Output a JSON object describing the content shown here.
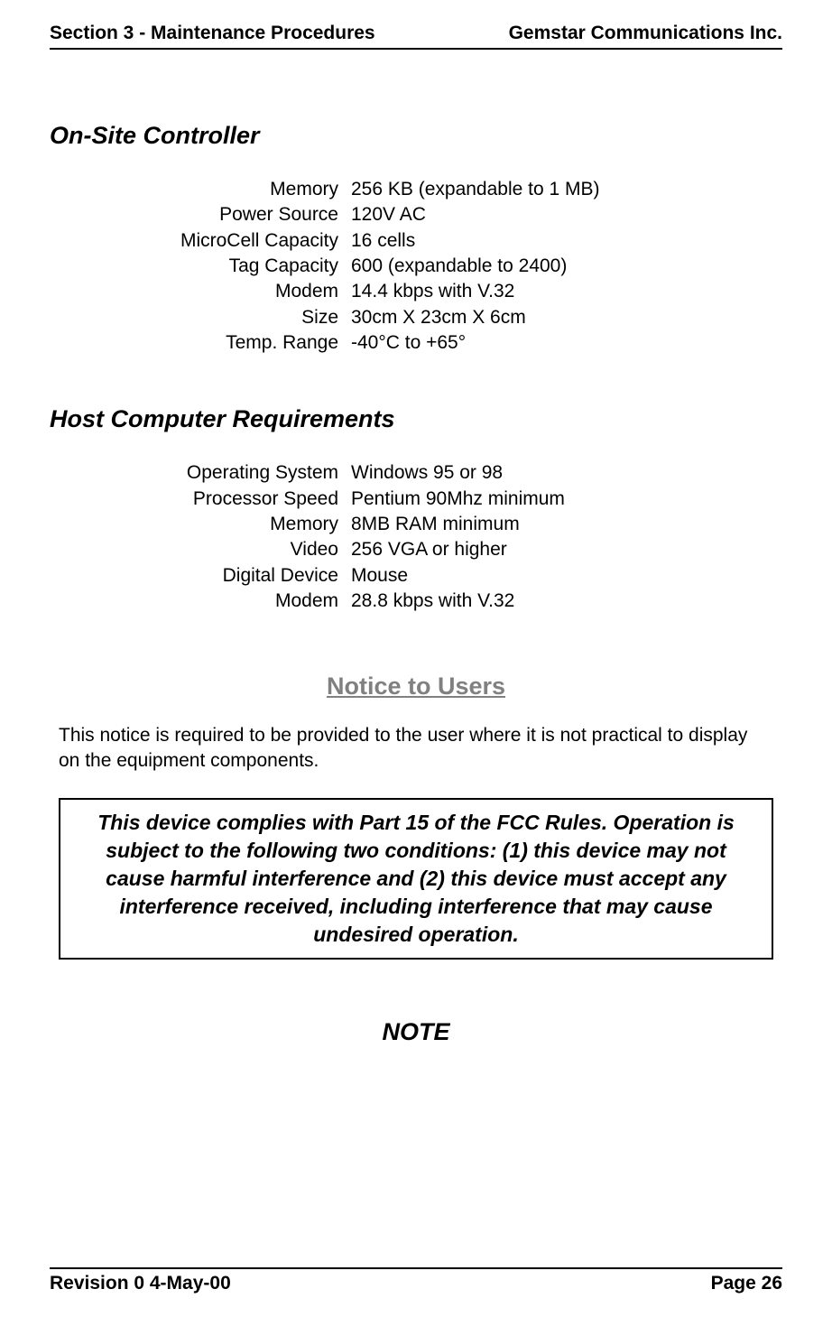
{
  "header": {
    "left": "Section 3 - Maintenance Procedures",
    "right": "Gemstar Communications Inc."
  },
  "sections": {
    "onsite": {
      "title": "On-Site Controller",
      "rows": [
        {
          "label": "Memory",
          "value": "256 KB (expandable to 1 MB)"
        },
        {
          "label": "Power Source",
          "value": "120V AC"
        },
        {
          "label": "MicroCell Capacity",
          "value": "16 cells"
        },
        {
          "label": "Tag Capacity",
          "value": "600 (expandable to 2400)"
        },
        {
          "label": "Modem",
          "value": "14.4 kbps with V.32"
        },
        {
          "label": "Size",
          "value": "30cm X 23cm X 6cm"
        },
        {
          "label": "Temp. Range",
          "value": "-40°C to +65°"
        }
      ]
    },
    "host": {
      "title": "Host Computer Requirements",
      "rows": [
        {
          "label": "Operating System",
          "value": "Windows 95 or 98"
        },
        {
          "label": "Processor Speed",
          "value": "Pentium 90Mhz minimum"
        },
        {
          "label": "Memory",
          "value": "8MB RAM minimum"
        },
        {
          "label": "Video",
          "value": "256 VGA or higher"
        },
        {
          "label": "Digital Device",
          "value": "Mouse"
        },
        {
          "label": "Modem",
          "value": "28.8 kbps with V.32"
        }
      ]
    }
  },
  "notice": {
    "heading": "Notice to Users",
    "paragraph": "This notice is required to be provided to the user where it is not practical to display on the equipment components.",
    "fcc": "This device complies with Part 15 of the FCC Rules. Operation is subject to the following two conditions: (1) this device may not cause harmful interference and (2) this device must accept any interference received, including interference that may cause undesired operation."
  },
  "note_heading": "NOTE",
  "footer": {
    "left": "Revision 0  4-May-00",
    "right": "Page 26"
  }
}
